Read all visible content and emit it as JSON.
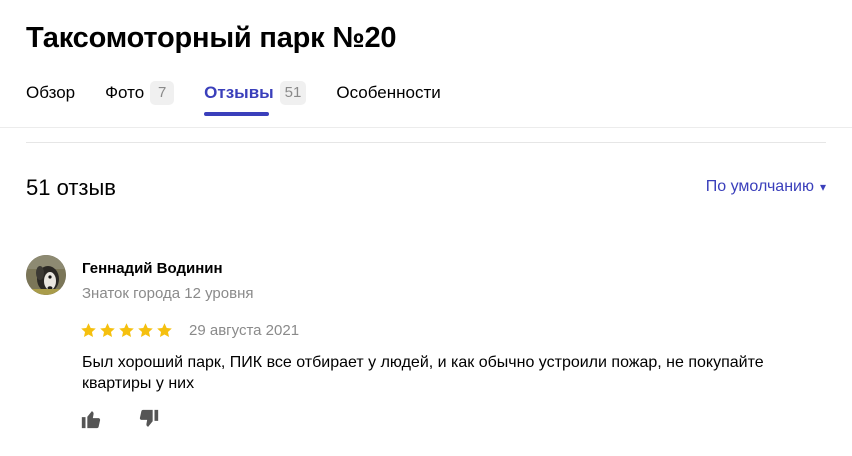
{
  "header": {
    "title": "Таксомоторный парк №20"
  },
  "tabs": [
    {
      "label": "Обзор",
      "count": null,
      "active": false
    },
    {
      "label": "Фото",
      "count": "7",
      "active": false
    },
    {
      "label": "Отзывы",
      "count": "51",
      "active": true
    },
    {
      "label": "Особенности",
      "count": null,
      "active": false
    }
  ],
  "reviews": {
    "count_label": "51 отзыв",
    "sort": {
      "label": "По умолчанию",
      "caret": "▾"
    },
    "items": [
      {
        "author": "Геннадий Водинин",
        "level": "Знаток города 12 уровня",
        "rating": 5,
        "max_rating": 5,
        "date": "29 августа 2021",
        "text": "Был хороший парк, ПИК все отбирает у людей, и как обычно устроили пожар, не покупайте квартиры у них",
        "reactions": [
          "thumbs-up-icon",
          "thumbs-down-icon"
        ]
      }
    ]
  },
  "colors": {
    "accent": "#3a3fbb",
    "star": "#f5c00f",
    "muted_text": "#8a8a8a",
    "badge_bg": "#f0f0f0"
  }
}
